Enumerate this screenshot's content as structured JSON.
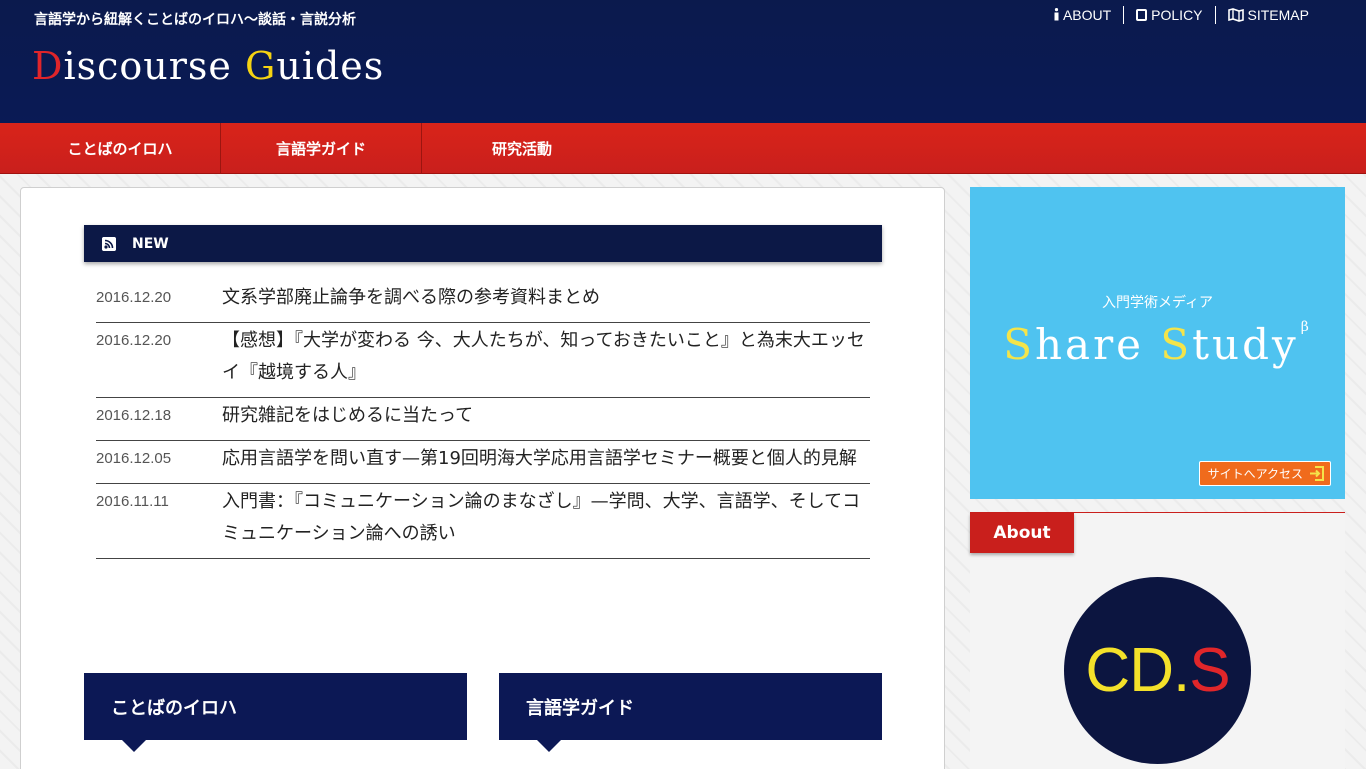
{
  "header": {
    "tagline": "言語学から紐解くことばのイロハ〜談話・言説分析",
    "logo_d": "D",
    "logo_rest1": "iscourse ",
    "logo_g": "G",
    "logo_rest2": "uides",
    "top_links": [
      {
        "label": "ABOUT",
        "icon": "info-icon"
      },
      {
        "label": "POLICY",
        "icon": "document-icon"
      },
      {
        "label": "SITEMAP",
        "icon": "map-icon"
      }
    ]
  },
  "nav": {
    "items": [
      {
        "label": "ことばのイロハ"
      },
      {
        "label": "言語学ガイド"
      },
      {
        "label": "研究活動"
      }
    ]
  },
  "main": {
    "new_heading": "NEW",
    "news": [
      {
        "date": "2016.12.20",
        "title": "文系学部廃止論争を調べる際の参考資料まとめ"
      },
      {
        "date": "2016.12.20",
        "title": "【感想】『大学が変わる 今、大人たちが、知っておきたいこと』と為末大エッセイ『越境する人』"
      },
      {
        "date": "2016.12.18",
        "title": "研究雑記をはじめるに当たって"
      },
      {
        "date": "2016.12.05",
        "title": "応用言語学を問い直す—第19回明海大学応用言語学セミナー概要と個人的見解"
      },
      {
        "date": "2016.11.11",
        "title": "入門書：『コミュニケーション論のまなざし』—学問、大学、言語学、そしてコミュニケーション論への誘い"
      }
    ],
    "categories": [
      {
        "label": "ことばのイロハ"
      },
      {
        "label": "言語学ガイド"
      }
    ]
  },
  "sidebar": {
    "banner": {
      "subtitle": "入門学術メディア",
      "title_s1": "S",
      "title_hare": "hare ",
      "title_s2": "S",
      "title_tudy": "tudy",
      "title_sup": "β",
      "button_label": "サイトへアクセス"
    },
    "about": {
      "heading": "About",
      "avatar_cd": "CD",
      "avatar_dot": ".",
      "avatar_s": "S"
    }
  },
  "colors": {
    "header_bg": "#0b1a4d",
    "nav_bg": "#d9241a",
    "banner_bg": "#4fc3f0",
    "accent_yellow": "#f5d312"
  }
}
